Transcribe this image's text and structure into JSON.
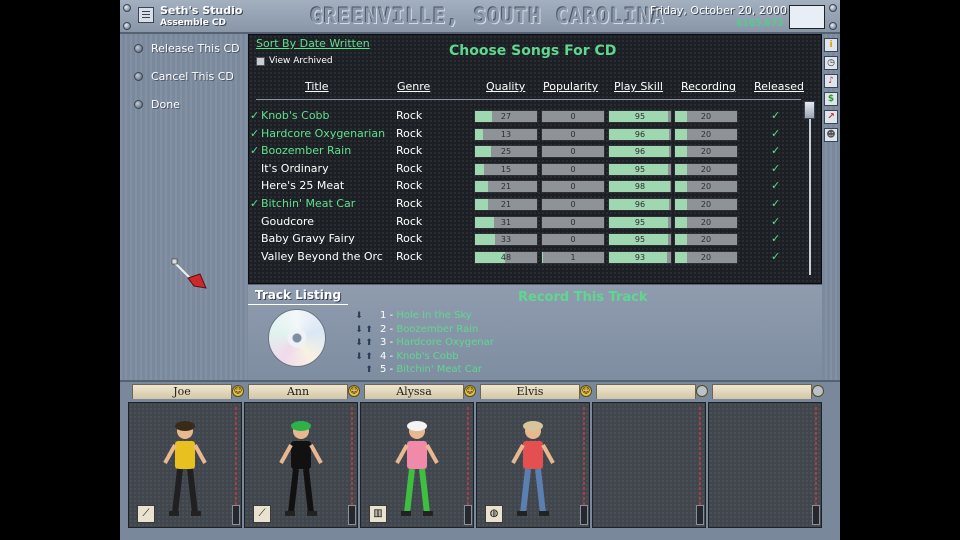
{
  "header": {
    "studio_name": "Seth's Studio",
    "studio_subtitle": "Assemble CD",
    "city": "GREENVILLE, SOUTH CAROLINA",
    "date": "Friday, October 20, 2000",
    "money": "$165,672"
  },
  "menu": {
    "items": [
      {
        "label": "Release This CD"
      },
      {
        "label": "Cancel This CD"
      },
      {
        "label": "Done"
      }
    ]
  },
  "songs_panel": {
    "sort_link": "Sort By Date Written",
    "view_archived": "View Archived",
    "title": "Choose Songs For CD",
    "columns": [
      "Title",
      "Genre",
      "Quality",
      "Popularity",
      "Play Skill",
      "Recording",
      "Released"
    ],
    "rows": [
      {
        "selected": true,
        "title": "Knob's Cobb",
        "genre": "Rock",
        "quality": 27,
        "popularity": 0,
        "play_skill": 95,
        "recording": 20,
        "released": true
      },
      {
        "selected": true,
        "title": "Hardcore Oxygenarian",
        "genre": "Rock",
        "quality": 13,
        "popularity": 0,
        "play_skill": 96,
        "recording": 20,
        "released": true
      },
      {
        "selected": true,
        "title": "Boozember Rain",
        "genre": "Rock",
        "quality": 25,
        "popularity": 0,
        "play_skill": 96,
        "recording": 20,
        "released": true
      },
      {
        "selected": false,
        "title": "It's Ordinary",
        "genre": "Rock",
        "quality": 15,
        "popularity": 0,
        "play_skill": 95,
        "recording": 20,
        "released": true
      },
      {
        "selected": false,
        "title": "Here's 25 Meat",
        "genre": "Rock",
        "quality": 21,
        "popularity": 0,
        "play_skill": 98,
        "recording": 20,
        "released": true
      },
      {
        "selected": true,
        "title": "Bitchin' Meat Car",
        "genre": "Rock",
        "quality": 21,
        "popularity": 0,
        "play_skill": 96,
        "recording": 20,
        "released": true
      },
      {
        "selected": false,
        "title": "Goudcore",
        "genre": "Rock",
        "quality": 31,
        "popularity": 0,
        "play_skill": 95,
        "recording": 20,
        "released": true
      },
      {
        "selected": false,
        "title": "Baby Gravy Fairy",
        "genre": "Rock",
        "quality": 33,
        "popularity": 0,
        "play_skill": 95,
        "recording": 20,
        "released": true
      },
      {
        "selected": false,
        "title": "Valley Beyond the Orc",
        "genre": "Rock",
        "quality": 48,
        "popularity": 1,
        "play_skill": 93,
        "recording": 20,
        "released": true
      }
    ],
    "check_glyph": "✓"
  },
  "toolbar": {
    "tools": [
      {
        "icon": "info-icon",
        "glyph": "i"
      },
      {
        "icon": "clock-icon",
        "glyph": "◷"
      },
      {
        "icon": "music-note-icon",
        "glyph": "♪"
      },
      {
        "icon": "money-icon",
        "glyph": "$"
      },
      {
        "icon": "chart-icon",
        "glyph": "↗"
      },
      {
        "icon": "people-icon",
        "glyph": "☻"
      }
    ]
  },
  "track_listing": {
    "title": "Track Listing",
    "record_link": "Record This Track",
    "tracks": [
      {
        "num": "1 - ",
        "name": "Hole In the Sky"
      },
      {
        "num": "2 - ",
        "name": "Boozember Rain"
      },
      {
        "num": "3 - ",
        "name": "Hardcore Oxygenar"
      },
      {
        "num": "4 - ",
        "name": "Knob's Cobb"
      },
      {
        "num": "5 - ",
        "name": "Bitchin' Meat Car"
      }
    ]
  },
  "band": {
    "members": [
      {
        "name": "Joe",
        "role": "guitar",
        "shirt": "#e8c020",
        "pants": "#202020",
        "hair": "#3a2a1a"
      },
      {
        "name": "Ann",
        "role": "guitar",
        "shirt": "#111111",
        "pants": "#111111",
        "hair": "#2bb34a"
      },
      {
        "name": "Alyssa",
        "role": "keyboard",
        "shirt": "#f08aa8",
        "pants": "#3fbf3f",
        "hair": "#f4f4f4"
      },
      {
        "name": "Elvis",
        "role": "drums",
        "shirt": "#e45050",
        "pants": "#5a7fb0",
        "hair": "#d8c49a"
      }
    ]
  }
}
